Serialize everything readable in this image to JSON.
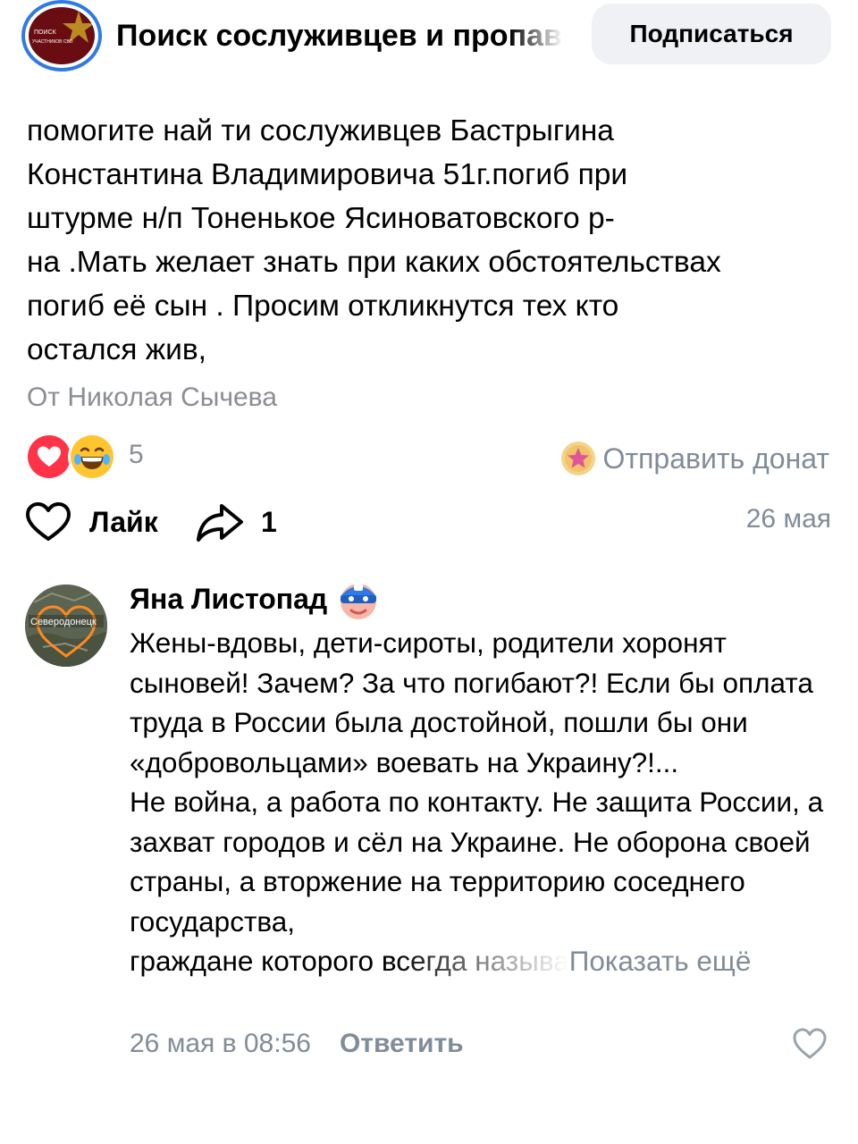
{
  "header": {
    "group_name": "Поиск сослуживцев и пропавших",
    "avatar_text_line1": "ПОИСК",
    "avatar_text_line2": "УЧАСТНИКОВ СВО",
    "subscribe_label": "Подписаться"
  },
  "post": {
    "text": "помогите най ти сослуживцев Бастрыгина\nКонстантина Владимировича 51г.погиб при\nштурме н/п Тоненькое Ясиноватовского р-\nна .Мать желает знать при каких обстоятельствах\nпогиб её сын . Просим откликнутся тех кто\nостался жив,",
    "author": "От Николая Сычева",
    "reactions": {
      "icons": [
        "heart-icon",
        "laughing-face-icon"
      ],
      "count": "5"
    },
    "donate_label": "Отправить донат",
    "like_label": "Лайк",
    "share_count": "1",
    "date": "26 мая"
  },
  "comment": {
    "avatar_label": "Северодонецк",
    "author": "Яна Листопад",
    "badge_icon": "masked-hero-badge-icon",
    "paragraph1": "Жены-вдовы, дети-сироты, родители хоронят сыновей! Зачем? За что погибают?! Если бы оплата труда в России была достойной, пошли бы они «добровольцами» воевать на Украину?!...",
    "paragraph2": "Не война, а работа по контакту. Не защита России, а захват городов и сёл на Украине. Не оборона своей страны, а вторжение на территорию соседнего государства,",
    "last_line": "граждане которого всегда называ",
    "show_more": "Показать ещё",
    "date": "26 мая в 08:56",
    "reply_label": "Ответить"
  },
  "colors": {
    "accent_blue": "#2f7ae5",
    "muted_text": "#818c99",
    "heart_red": "#ff3347",
    "group_avatar_bg": "#6a0d12"
  }
}
